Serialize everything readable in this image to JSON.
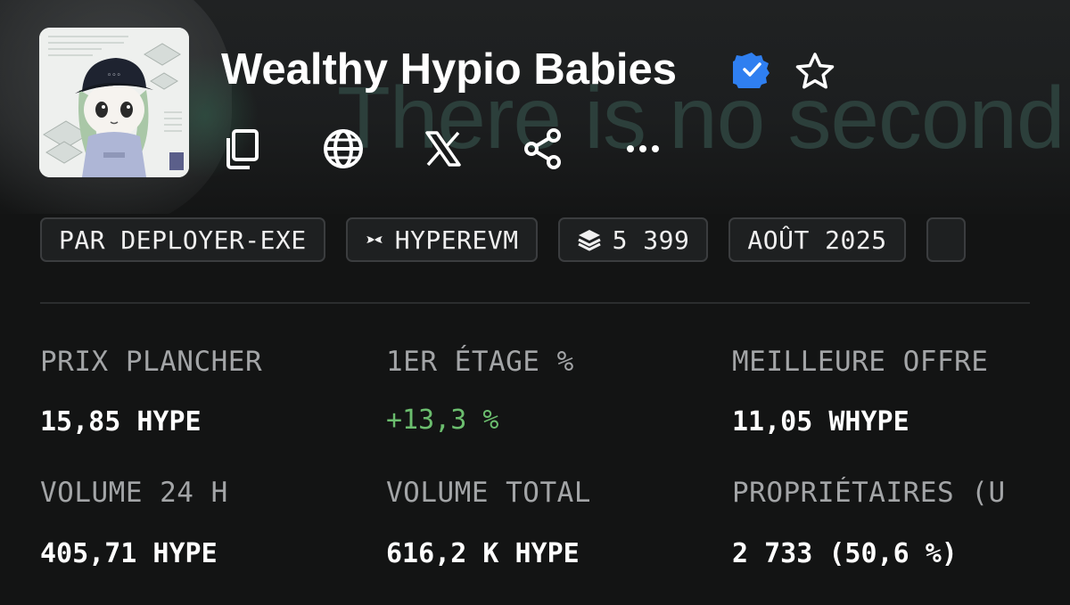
{
  "banner": {
    "text": "There is no second"
  },
  "collection": {
    "name": "Wealthy Hypio Babies",
    "verified": true,
    "favorite": false
  },
  "actions": [
    {
      "name": "copy",
      "icon": "copy-icon"
    },
    {
      "name": "website",
      "icon": "globe-icon"
    },
    {
      "name": "x",
      "icon": "x-logo-icon"
    },
    {
      "name": "share",
      "icon": "share-icon"
    },
    {
      "name": "more",
      "icon": "more-icon"
    }
  ],
  "chips": {
    "creator": "PAR DEPLOYER-EXE",
    "chain": "HYPEREVM",
    "items": "5 399",
    "date": "AOÛT 2025"
  },
  "stats": {
    "floor": {
      "label": "PRIX PLANCHER",
      "value": "15,85 HYPE"
    },
    "first_floor": {
      "label": "1ER ÉTAGE %",
      "value": "+13,3 %"
    },
    "best_offer": {
      "label": "MEILLEURE OFFRE",
      "value": "11,05 WHYPE"
    },
    "volume_24h": {
      "label": "VOLUME 24 H",
      "value": "405,71 HYPE"
    },
    "volume_total": {
      "label": "VOLUME TOTAL",
      "value": "616,2 K HYPE"
    },
    "owners": {
      "label": "PROPRIÉTAIRES (U",
      "value": "2 733 (50,6 %)"
    }
  },
  "colors": {
    "background": "#131414",
    "accent_verified": "#2f7ff0",
    "positive": "#6bbd6e",
    "label": "#a3a5a7"
  }
}
